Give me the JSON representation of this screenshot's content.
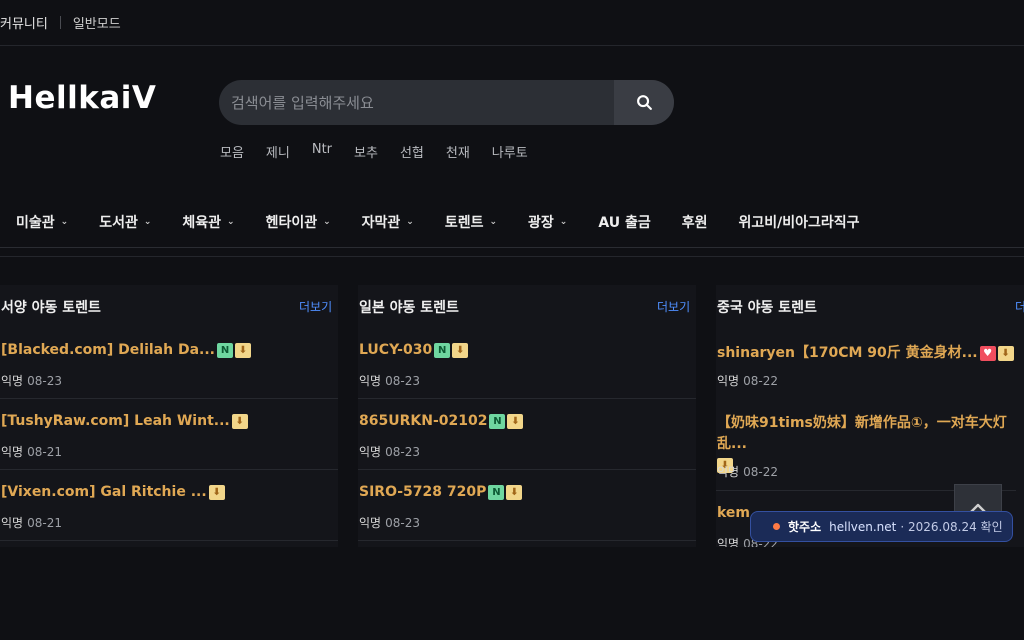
{
  "topbar": {
    "community": "커뮤니티",
    "mode": "일반모드"
  },
  "logo": "HellkaiV",
  "search": {
    "placeholder": "검색어를 입력해주세요",
    "keywords": [
      "모음",
      "제니",
      "Ntr",
      "보추",
      "선협",
      "천재",
      "나루토"
    ]
  },
  "nav": [
    "미술관",
    "도서관",
    "체육관",
    "헨타이관",
    "자막관",
    "토렌트",
    "광장",
    "AU 출금",
    "후원",
    "위고비/비아그라직구"
  ],
  "nav_chevron": "⌄",
  "panels": [
    {
      "title": "서양 야동 토렌트",
      "more": "더보기",
      "rows": [
        {
          "title": "[Blacked.com] Delilah Da...",
          "author": "익명",
          "date": "08-23"
        },
        {
          "title": "[TushyRaw.com] Leah Wint...",
          "author": "익명",
          "date": "08-21"
        },
        {
          "title": "[Vixen.com] Gal Ritchie ...",
          "author": "익명",
          "date": "08-21"
        }
      ]
    },
    {
      "title": "일본 야동 토렌트",
      "more": "더보기",
      "rows": [
        {
          "title": "LUCY-030",
          "author": "익명",
          "date": "08-23"
        },
        {
          "title": "865URKN-02102",
          "author": "익명",
          "date": "08-23"
        },
        {
          "title": "SIRO-5728 720P",
          "author": "익명",
          "date": "08-23"
        }
      ]
    },
    {
      "title": "중국 야동 토렌트",
      "more": "더",
      "rows": [
        {
          "title": "shinaryen【170CM 90斤 黄金身材...",
          "author": "익명",
          "date": "08-22"
        },
        {
          "title": "【奶味91tims奶妹】新增作品①，一对车大灯乱...",
          "author": "익명",
          "date": "08-22"
        },
        {
          "title": "kem",
          "author": "익명",
          "date": "08-22"
        }
      ]
    }
  ],
  "badges": {
    "new": "N",
    "download": "⬇",
    "hot": "♥"
  },
  "hot_address": {
    "label": "핫주소",
    "url": "hellven.net",
    "date": "· 2026.08.24 확인"
  }
}
